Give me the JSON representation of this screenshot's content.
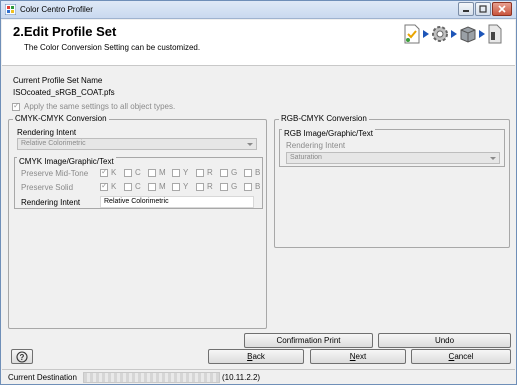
{
  "window": {
    "title": "Color Centro Profiler"
  },
  "header": {
    "step_title": "2.Edit Profile Set",
    "description": "The Color  Conversion Setting can be customized.",
    "icons": [
      "document-star-icon",
      "gear-icon",
      "box-icon",
      "profile-document-icon"
    ]
  },
  "profile": {
    "label": "Current Profile Set Name",
    "name": "ISOcoated_sRGB_COAT.pfs"
  },
  "apply_all": {
    "label": "Apply the same settings to all object types.",
    "checked": true
  },
  "cmyk_cmyk": {
    "title": "CMYK-CMYK Conversion",
    "rendering_intent_label": "Rendering Intent",
    "rendering_intent_value": "Relative Colorimetric",
    "sub": {
      "title": "CMYK Image/Graphic/Text",
      "preserve_midtone_label": "Preserve Mid-Tone",
      "preserve_solid_label": "Preserve Solid",
      "channels": [
        "K",
        "C",
        "M",
        "Y",
        "R",
        "G",
        "B"
      ],
      "midtone_checked": [
        true,
        false,
        false,
        false,
        false,
        false,
        false
      ],
      "solid_checked": [
        true,
        false,
        false,
        false,
        false,
        false,
        false
      ],
      "rendering_intent_label": "Rendering Intent",
      "rendering_intent_value": "Relative Colorimetric"
    }
  },
  "rgb_cmyk": {
    "title": "RGB-CMYK Conversion",
    "sub": {
      "title": "RGB Image/Graphic/Text",
      "rendering_intent_label": "Rendering Intent",
      "rendering_intent_value": "Saturation"
    }
  },
  "buttons": {
    "confirmation_print": "Confirmation Print",
    "undo": "Undo",
    "back": "Back",
    "next": "Next",
    "cancel": "Cancel",
    "back_mnemonic": "B",
    "back_rest": "ack",
    "next_mnemonic": "N",
    "next_rest": "ext",
    "cancel_mnemonic": "C",
    "cancel_rest": "ancel"
  },
  "status": {
    "label": "Current Destination",
    "suffix": "(10.11.2.2)"
  },
  "colors": {
    "accent": "#1d55b8",
    "titlebar": "#c9d9ef",
    "close": "#c8553e"
  }
}
